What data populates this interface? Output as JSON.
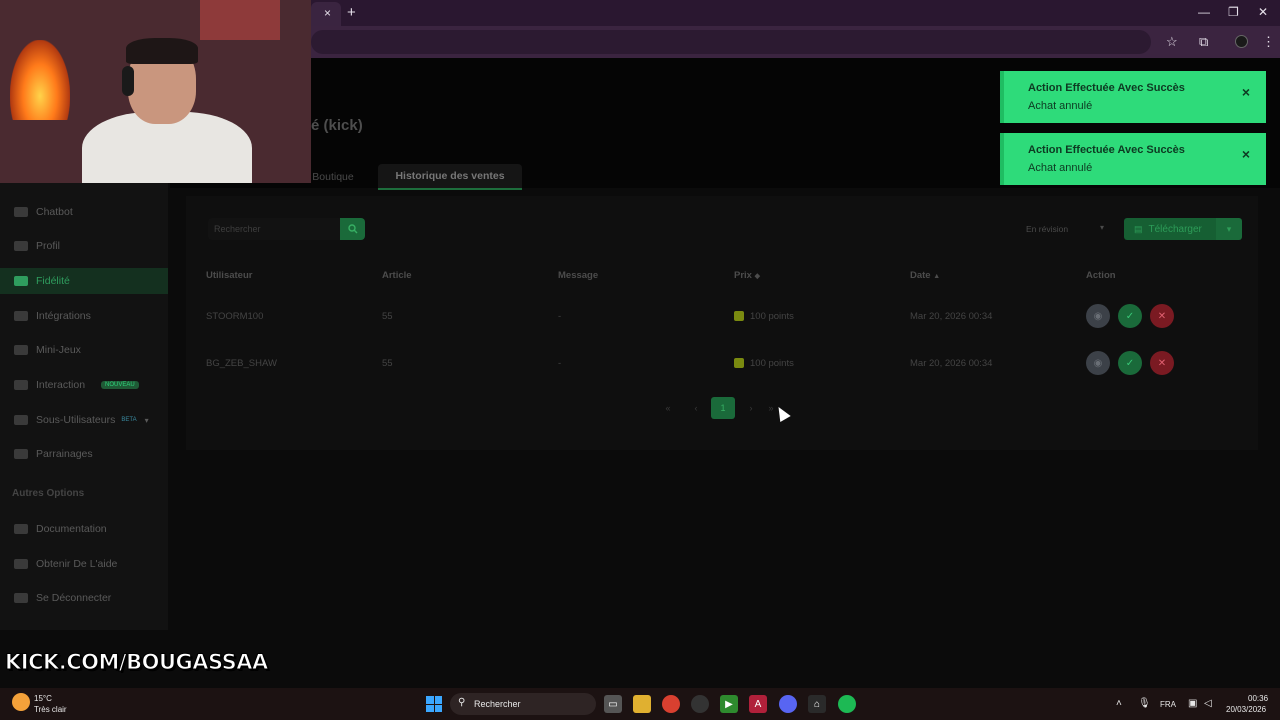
{
  "browser": {
    "tab_close": "×",
    "new_tab": "+",
    "window_controls": [
      "—",
      "❐",
      "✕"
    ],
    "toolbar_icons": [
      "☆",
      "⧉",
      "⋮"
    ]
  },
  "page": {
    "title": "é (kick)",
    "tabs": [
      {
        "label": "Boutique"
      },
      {
        "label": "Historique des ventes"
      }
    ]
  },
  "sidebar": {
    "items": [
      {
        "label": "Chatbot",
        "icon": "chatbot-icon"
      },
      {
        "label": "Profil",
        "icon": "profile-icon"
      },
      {
        "label": "Fidélité",
        "icon": "loyalty-icon",
        "active": true
      },
      {
        "label": "Intégrations",
        "icon": "integrations-icon"
      },
      {
        "label": "Mini-Jeux",
        "icon": "gamepad-icon"
      },
      {
        "label": "Interaction",
        "icon": "music-icon",
        "badge": "NOUVEAU"
      },
      {
        "label": "Sous-Utilisateurs",
        "icon": "users-icon",
        "badge": "BETA"
      },
      {
        "label": "Parrainages",
        "icon": "referral-icon"
      }
    ],
    "section_title": "Autres Options",
    "other_items": [
      {
        "label": "Documentation",
        "icon": "docs-icon"
      },
      {
        "label": "Obtenir De L'aide",
        "icon": "help-icon"
      },
      {
        "label": "Se Déconnecter",
        "icon": "logout-icon"
      }
    ]
  },
  "toolbar": {
    "search_placeholder": "Rechercher",
    "status_select": "En révision",
    "download_label": "Télécharger"
  },
  "table": {
    "headers": [
      "Utilisateur",
      "Article",
      "Message",
      "Prix",
      "Date",
      "Action"
    ],
    "rows": [
      {
        "user": "STOORM100",
        "article": "55",
        "message": "-",
        "price": "100 points",
        "date": "Mar 20, 2026 00:34"
      },
      {
        "user": "BG_ZEB_SHAW",
        "article": "55",
        "message": "-",
        "price": "100 points",
        "date": "Mar 20, 2026 00:34"
      }
    ]
  },
  "pagination": {
    "first": "«",
    "prev": "‹",
    "current": "1",
    "next": "›",
    "last": "»"
  },
  "toasts": [
    {
      "title": "Action Effectuée Avec Succès",
      "message": "Achat annulé",
      "close": "×"
    },
    {
      "title": "Action Effectuée Avec Succès",
      "message": "Achat annulé",
      "close": "×"
    }
  ],
  "overlay": {
    "banner": "KICK.COM/BOUGASSAA"
  },
  "taskbar": {
    "temperature": "15°C",
    "weather": "Très clair",
    "search": "Rechercher",
    "language": "FRA",
    "time": "00:36",
    "date": "20/03/2026"
  },
  "colors": {
    "toast_bg": "#2edb7a",
    "accent_green": "#1a6a3a",
    "danger": "#7a1a22"
  }
}
